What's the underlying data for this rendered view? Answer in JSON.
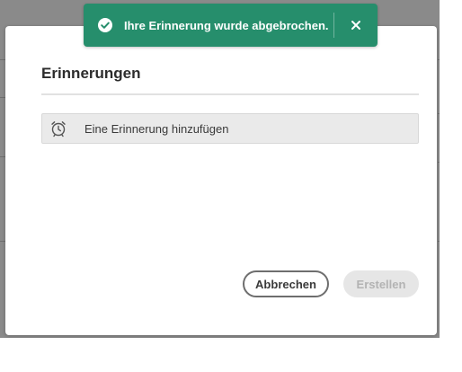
{
  "toast": {
    "message": "Ihre Erinnerung wurde abgebrochen.",
    "icon": "check-circle-icon",
    "close_icon": "close-icon",
    "color": "#268e6c"
  },
  "dialog": {
    "title": "Erinnerungen",
    "add_reminder": {
      "label": "Eine Erinnerung hinzufügen",
      "icon": "alarm-clock-icon"
    },
    "buttons": {
      "cancel": "Abbrechen",
      "create": "Erstellen"
    }
  }
}
